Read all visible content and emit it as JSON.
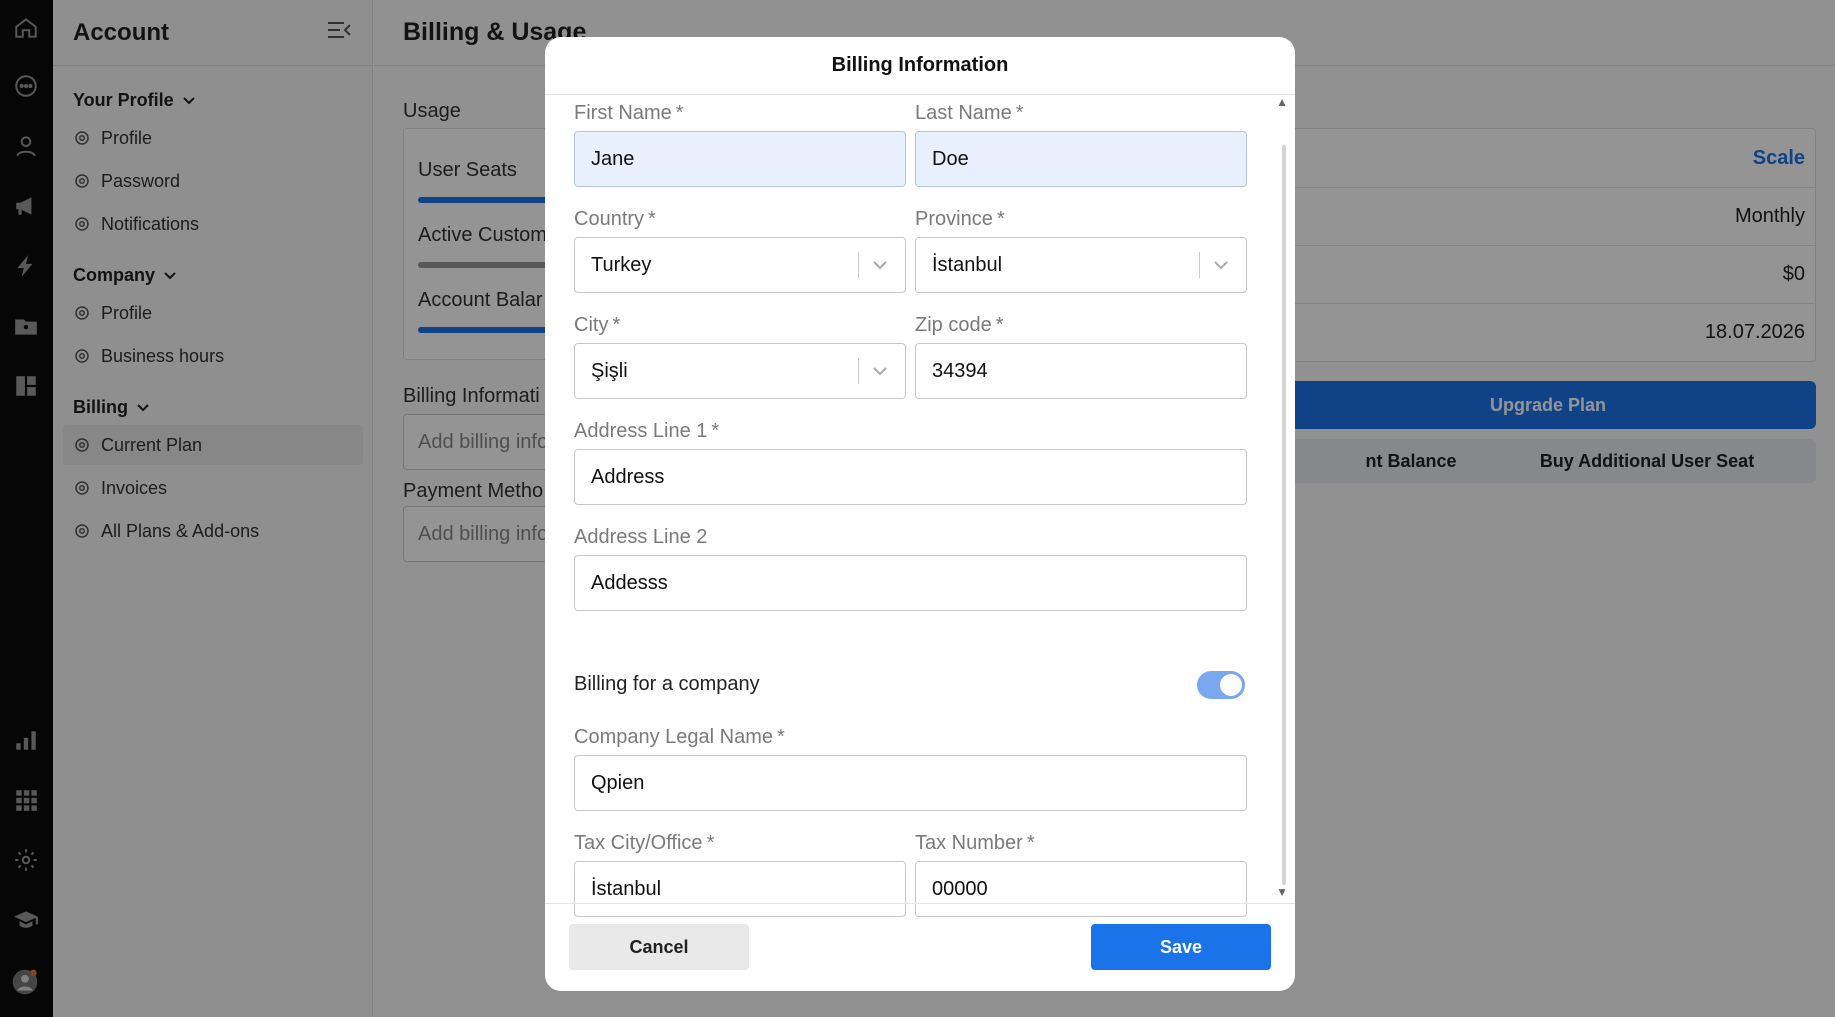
{
  "rail": {
    "icons": [
      "home-icon",
      "chat-icon",
      "user-icon",
      "megaphone-icon",
      "lightning-icon",
      "contacts-icon",
      "dashboard-icon",
      "reports-icon",
      "apps-grid-icon",
      "settings-icon",
      "academy-icon",
      "avatar"
    ]
  },
  "sidebar": {
    "title": "Account",
    "groups": [
      {
        "title": "Your Profile",
        "items": [
          "Profile",
          "Password",
          "Notifications"
        ]
      },
      {
        "title": "Company",
        "items": [
          "Profile",
          "Business hours"
        ]
      },
      {
        "title": "Billing",
        "items": [
          "Current Plan",
          "Invoices",
          "All Plans & Add-ons"
        ]
      }
    ],
    "active_item": "Current Plan"
  },
  "main": {
    "title": "Billing & Usage",
    "usage_label": "Usage",
    "usage_rows": [
      "User Seats",
      "Active Custom",
      "Account Balar"
    ],
    "billing_info_label": "Billing Informati",
    "billing_info_placeholder": "Add billing info",
    "payment_method_label": "Payment Metho",
    "payment_method_placeholder": "Add billing info",
    "plan_rows": [
      "Scale",
      "Monthly",
      "$0",
      "18.07.2026"
    ],
    "upgrade_label": "Upgrade Plan",
    "account_balance_label": "nt Balance",
    "buy_seat_label": "Buy Additional User Seat"
  },
  "modal": {
    "title": "Billing Information",
    "first_name": {
      "label": "First Name",
      "value": "Jane"
    },
    "last_name": {
      "label": "Last Name",
      "value": "Doe"
    },
    "country": {
      "label": "Country",
      "value": "Turkey"
    },
    "province": {
      "label": "Province",
      "value": "İstanbul"
    },
    "city": {
      "label": "City",
      "value": "Şişli"
    },
    "zip": {
      "label": "Zip code",
      "value": "34394"
    },
    "address1": {
      "label": "Address Line 1",
      "value": "Address"
    },
    "address2": {
      "label": "Address Line 2",
      "value": "Addesss"
    },
    "billing_company_label": "Billing for a company",
    "billing_company_enabled": true,
    "company_name": {
      "label": "Company Legal Name",
      "value": "Qpien"
    },
    "tax_office": {
      "label": "Tax City/Office",
      "value": "İstanbul"
    },
    "tax_number": {
      "label": "Tax Number",
      "value": "00000"
    },
    "required_mark": "*",
    "cancel_label": "Cancel",
    "save_label": "Save"
  },
  "colors": {
    "accent": "#1a73e8",
    "rail": "#0c0c0c",
    "autofill": "#e8f0fe"
  }
}
